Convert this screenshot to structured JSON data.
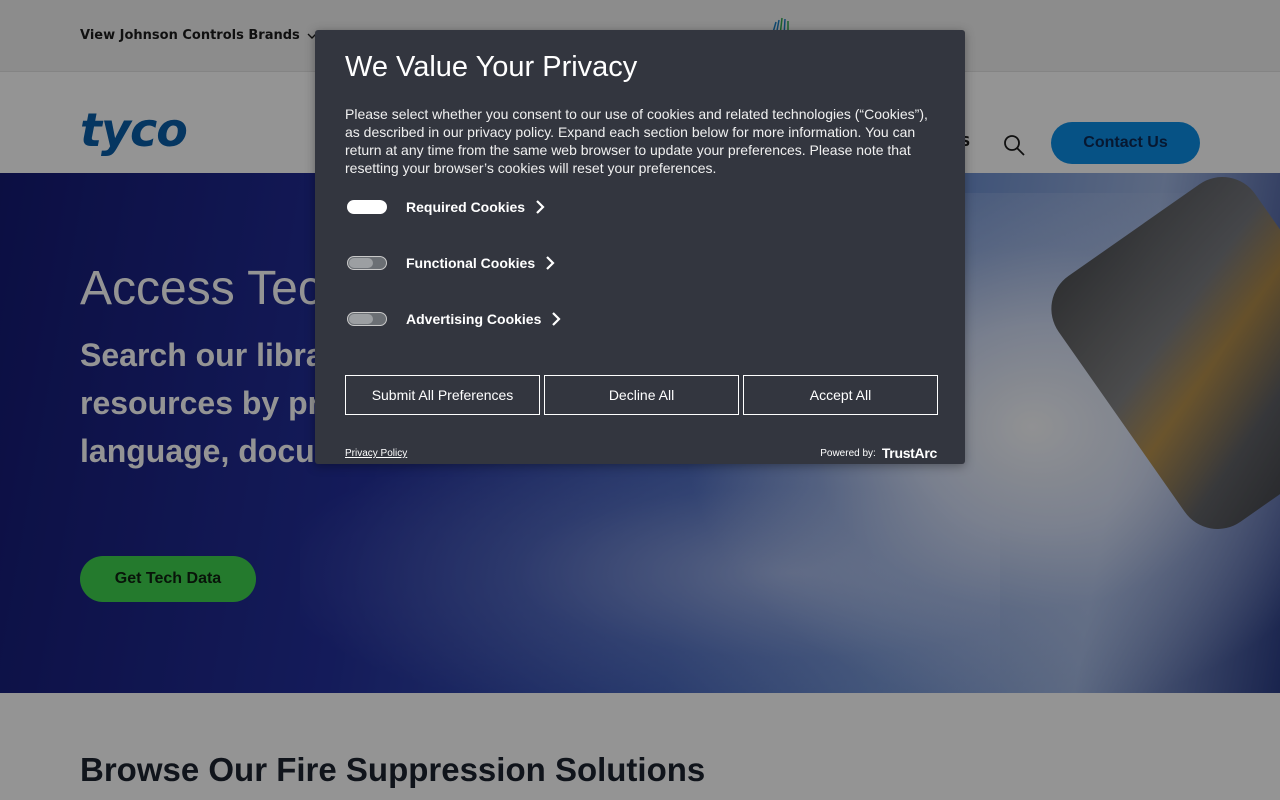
{
  "topbar": {
    "brands_label": "View Johnson Controls Brands"
  },
  "navbar": {
    "logo_text": "tyco",
    "nav_partial": "TS",
    "contact_label": "Contact Us"
  },
  "hero": {
    "title": "Access Tech",
    "subtitle_line1": "Search our librar",
    "subtitle_line2": "resources by pro",
    "subtitle_line3": "language, docu",
    "cta_label": "Get Tech Data"
  },
  "browse": {
    "title": "Browse Our Fire Suppression Solutions"
  },
  "dialog": {
    "title": "We Value Your Privacy",
    "description": "Please select whether you consent to our use of cookies and related technologies (“Cookies”), as described in our privacy policy. Expand each section below for more information. You can return at any time from the same web browser to update your preferences. Please note that resetting your browser’s cookies will reset your preferences.",
    "categories": [
      {
        "label": "Required Cookies",
        "enabled": true
      },
      {
        "label": "Functional Cookies",
        "enabled": false
      },
      {
        "label": "Advertising Cookies",
        "enabled": false
      }
    ],
    "buttons": {
      "submit": "Submit All Preferences",
      "decline": "Decline All",
      "accept": "Accept All"
    },
    "privacy_link": "Privacy Policy",
    "powered_by": "Powered by:",
    "trustarc": "TrustArc"
  },
  "colors": {
    "dialog_bg": "#33363f",
    "brand_blue": "#0a5da8",
    "contact_button": "#0b8ee6",
    "cta_green": "#3fd34f"
  },
  "icons": [
    "chevron-down-icon",
    "search-icon",
    "chevron-right-icon",
    "jci-logo-icon"
  ]
}
